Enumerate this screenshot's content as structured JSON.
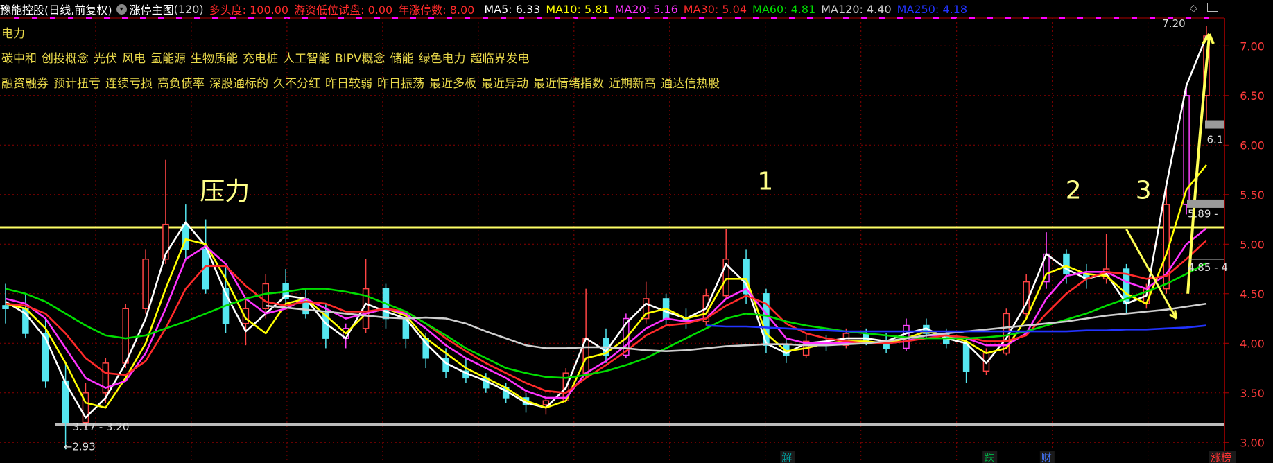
{
  "header": {
    "stock_name": "豫能控股",
    "period": "(日线,前复权)",
    "indicator": "涨停主图",
    "indicator_count": "(120)",
    "metrics": [
      {
        "label": "多头度:",
        "value": "100.00",
        "color": "#ff2a2a"
      },
      {
        "label": "游资低位试盘:",
        "value": "0.00",
        "color": "#ff2a2a"
      },
      {
        "label": "年涨停数:",
        "value": "8.00",
        "color": "#ff2a2a"
      }
    ],
    "ma": [
      {
        "label": "MA5:",
        "value": "6.33",
        "color": "#ffffff"
      },
      {
        "label": "MA10:",
        "value": "5.81",
        "color": "#ffff00"
      },
      {
        "label": "MA20:",
        "value": "5.16",
        "color": "#ff33ff"
      },
      {
        "label": "MA30:",
        "value": "5.04",
        "color": "#ff2a2a"
      },
      {
        "label": "MA60:",
        "value": "4.81",
        "color": "#00dd00"
      },
      {
        "label": "MA120:",
        "value": "4.40",
        "color": "#cfcfcf"
      },
      {
        "label": "MA250:",
        "value": "4.18",
        "color": "#2233ff"
      }
    ]
  },
  "tags": {
    "industry": "电力",
    "concepts": [
      "碳中和",
      "创投概念",
      "光伏",
      "风电",
      "氢能源",
      "生物质能",
      "充电桩",
      "人工智能",
      "BIPV概念",
      "储能",
      "绿色电力",
      "超临界发电"
    ],
    "features": [
      "融资融券",
      "预计扭亏",
      "连续亏损",
      "高负债率",
      "深股通标的",
      "久不分红",
      "昨日较弱",
      "昨日振荡",
      "最近多板",
      "最近异动",
      "最近情绪指数",
      "近期新高",
      "通达信热股"
    ]
  },
  "chart_data": {
    "type": "candlestick",
    "title": "",
    "xlabel": "",
    "ylabel": "",
    "ylim": [
      2.92,
      7.35
    ],
    "y_ticks": [
      "7.00",
      "6.50",
      "6.00",
      "5.50",
      "5.00",
      "4.50",
      "4.00",
      "3.50",
      "3.00"
    ],
    "pressure_line": 5.17,
    "support_line": 3.18,
    "annotations": [
      {
        "text": "压力",
        "x": 0.157,
        "y": 5.45
      },
      {
        "text": "1",
        "x": 0.595,
        "y": 5.55
      },
      {
        "text": "2",
        "x": 0.837,
        "y": 5.46
      },
      {
        "text": "3",
        "x": 0.892,
        "y": 5.46
      }
    ],
    "price_labels": [
      {
        "text": "3.17 - 3.20",
        "x": 0.057,
        "y": 3.12
      },
      {
        "text": "←2.93",
        "x": 0.05,
        "y": 2.92
      },
      {
        "text": "7.20",
        "x": 0.913,
        "y": 7.19
      },
      {
        "text": "5.89 -",
        "x": 0.933,
        "y": 5.27
      },
      {
        "text": "4.85 - 4",
        "x": 0.933,
        "y": 4.73
      },
      {
        "text": "6.1",
        "x": 0.948,
        "y": 6.02
      }
    ],
    "markers": [
      {
        "text": "解",
        "x": 0.614,
        "color": "#00a0a0"
      },
      {
        "text": "跌",
        "x": 0.773,
        "color": "#00aa44"
      },
      {
        "text": "财",
        "x": 0.818,
        "color": "#4477ff"
      },
      {
        "text": "涨榜",
        "x": 0.951,
        "color": "#ff3333"
      }
    ],
    "series": [
      {
        "name": "MA5",
        "color": "#ffffff",
        "values": [
          4.42,
          4.3,
          4.05,
          3.6,
          3.25,
          3.45,
          3.8,
          4.25,
          4.9,
          5.22,
          4.98,
          4.5,
          4.12,
          4.3,
          4.48,
          4.45,
          4.2,
          4.05,
          4.4,
          4.32,
          4.25,
          4.0,
          3.8,
          3.7,
          3.62,
          3.52,
          3.4,
          3.35,
          3.55,
          4.05,
          3.92,
          4.2,
          4.4,
          4.32,
          4.25,
          4.35,
          4.8,
          4.6,
          4.0,
          3.9,
          4.0,
          4.02,
          4.05,
          4.05,
          4.02,
          4.1,
          4.15,
          4.05,
          4.0,
          3.8,
          4.05,
          4.4,
          4.9,
          4.75,
          4.65,
          4.7,
          4.4,
          4.48,
          5.6,
          6.6,
          7.1
        ]
      },
      {
        "name": "MA10",
        "color": "#ffff00",
        "values": [
          4.4,
          4.35,
          4.15,
          3.8,
          3.4,
          3.35,
          3.65,
          4.0,
          4.55,
          5.05,
          5.0,
          4.65,
          4.25,
          4.1,
          4.4,
          4.45,
          4.28,
          4.1,
          4.3,
          4.35,
          4.28,
          4.05,
          3.9,
          3.75,
          3.65,
          3.55,
          3.42,
          3.35,
          3.42,
          3.85,
          3.9,
          4.05,
          4.3,
          4.35,
          4.25,
          4.3,
          4.65,
          4.65,
          4.1,
          3.92,
          3.95,
          4.0,
          4.02,
          4.02,
          4.0,
          4.05,
          4.12,
          4.08,
          4.02,
          3.9,
          3.95,
          4.25,
          4.7,
          4.78,
          4.7,
          4.68,
          4.5,
          4.4,
          4.9,
          5.55,
          5.8
        ]
      },
      {
        "name": "MA20",
        "color": "#ff33ff",
        "values": [
          4.45,
          4.4,
          4.25,
          3.95,
          3.65,
          3.55,
          3.62,
          3.9,
          4.35,
          4.85,
          4.98,
          4.8,
          4.45,
          4.3,
          4.35,
          4.45,
          4.35,
          4.25,
          4.3,
          4.35,
          4.3,
          4.15,
          3.98,
          3.85,
          3.75,
          3.65,
          3.52,
          3.45,
          3.45,
          3.7,
          3.82,
          3.98,
          4.15,
          4.25,
          4.22,
          4.25,
          4.45,
          4.55,
          4.3,
          4.05,
          4.0,
          4.0,
          4.0,
          4.0,
          4.0,
          4.02,
          4.08,
          4.08,
          4.05,
          3.98,
          3.98,
          4.1,
          4.45,
          4.68,
          4.72,
          4.72,
          4.62,
          4.55,
          4.7,
          5.0,
          5.16
        ]
      },
      {
        "name": "MA30",
        "color": "#ff2a2a",
        "values": [
          4.4,
          4.38,
          4.3,
          4.1,
          3.85,
          3.7,
          3.68,
          3.82,
          4.15,
          4.55,
          4.78,
          4.78,
          4.58,
          4.42,
          4.38,
          4.42,
          4.4,
          4.32,
          4.32,
          4.35,
          4.32,
          4.2,
          4.05,
          3.92,
          3.8,
          3.7,
          3.6,
          3.52,
          3.5,
          3.65,
          3.78,
          3.92,
          4.08,
          4.18,
          4.2,
          4.25,
          4.38,
          4.48,
          4.4,
          4.2,
          4.1,
          4.05,
          4.02,
          4.0,
          4.0,
          4.02,
          4.05,
          4.08,
          4.06,
          4.02,
          4.02,
          4.08,
          4.3,
          4.5,
          4.65,
          4.72,
          4.7,
          4.65,
          4.68,
          4.85,
          5.04
        ]
      },
      {
        "name": "MA60",
        "color": "#00dd00",
        "values": [
          4.55,
          4.5,
          4.42,
          4.3,
          4.18,
          4.08,
          4.05,
          4.08,
          4.15,
          4.22,
          4.3,
          4.38,
          4.45,
          4.5,
          4.52,
          4.55,
          4.55,
          4.52,
          4.48,
          4.4,
          4.32,
          4.2,
          4.08,
          3.95,
          3.85,
          3.75,
          3.7,
          3.66,
          3.65,
          3.68,
          3.72,
          3.78,
          3.85,
          3.95,
          4.05,
          4.15,
          4.25,
          4.3,
          4.28,
          4.22,
          4.18,
          4.15,
          4.12,
          4.1,
          4.08,
          4.06,
          4.05,
          4.05,
          4.05,
          4.06,
          4.08,
          4.12,
          4.18,
          4.24,
          4.3,
          4.38,
          4.45,
          4.52,
          4.6,
          4.7,
          4.81
        ]
      },
      {
        "name": "MA120",
        "color": "#cfcfcf",
        "values": [
          null,
          null,
          null,
          null,
          null,
          null,
          null,
          null,
          null,
          null,
          null,
          null,
          null,
          4.38,
          4.36,
          4.34,
          4.32,
          4.3,
          4.28,
          4.26,
          4.25,
          4.26,
          4.25,
          4.2,
          4.12,
          4.05,
          3.98,
          3.95,
          3.95,
          3.96,
          3.96,
          3.95,
          3.93,
          3.92,
          3.93,
          3.95,
          3.97,
          3.98,
          3.99,
          3.99,
          3.98,
          3.98,
          3.99,
          4.0,
          4.02,
          4.05,
          4.08,
          4.1,
          4.12,
          4.14,
          4.16,
          4.18,
          4.2,
          4.22,
          4.25,
          4.28,
          4.3,
          4.32,
          4.34,
          4.37,
          4.4
        ]
      },
      {
        "name": "MA250",
        "color": "#2233ff",
        "values": [
          null,
          null,
          null,
          null,
          null,
          null,
          null,
          null,
          null,
          null,
          null,
          null,
          null,
          null,
          null,
          null,
          null,
          null,
          null,
          null,
          null,
          null,
          null,
          null,
          null,
          null,
          null,
          null,
          null,
          null,
          null,
          null,
          null,
          null,
          null,
          4.18,
          4.17,
          4.17,
          4.16,
          4.15,
          4.14,
          4.13,
          4.12,
          4.12,
          4.12,
          4.12,
          4.12,
          4.12,
          4.12,
          4.12,
          4.12,
          4.12,
          4.12,
          4.12,
          4.13,
          4.13,
          4.14,
          4.14,
          4.15,
          4.16,
          4.18
        ]
      }
    ],
    "candles": [
      {
        "o": 4.38,
        "h": 4.6,
        "l": 4.2,
        "c": 4.35
      },
      {
        "o": 4.35,
        "h": 4.5,
        "l": 4.05,
        "c": 4.1
      },
      {
        "o": 4.1,
        "h": 4.25,
        "l": 3.55,
        "c": 3.62
      },
      {
        "o": 3.62,
        "h": 3.8,
        "l": 2.93,
        "c": 3.2
      },
      {
        "o": 3.2,
        "h": 3.6,
        "l": 3.15,
        "c": 3.5
      },
      {
        "o": 3.5,
        "h": 3.85,
        "l": 3.4,
        "c": 3.8
      },
      {
        "o": 3.8,
        "h": 4.4,
        "l": 3.75,
        "c": 4.35
      },
      {
        "o": 4.35,
        "h": 4.95,
        "l": 4.3,
        "c": 4.85
      },
      {
        "o": 4.85,
        "h": 5.85,
        "l": 4.8,
        "c": 5.2
      },
      {
        "o": 5.2,
        "h": 5.4,
        "l": 4.85,
        "c": 4.95
      },
      {
        "o": 4.95,
        "h": 5.25,
        "l": 4.5,
        "c": 4.55
      },
      {
        "o": 4.55,
        "h": 4.8,
        "l": 4.1,
        "c": 4.2
      },
      {
        "o": 4.2,
        "h": 4.45,
        "l": 3.98,
        "c": 4.35
      },
      {
        "o": 4.35,
        "h": 4.7,
        "l": 4.25,
        "c": 4.6
      },
      {
        "o": 4.6,
        "h": 4.75,
        "l": 4.35,
        "c": 4.45
      },
      {
        "o": 4.45,
        "h": 4.55,
        "l": 4.25,
        "c": 4.3
      },
      {
        "o": 4.3,
        "h": 4.4,
        "l": 3.95,
        "c": 4.05
      },
      {
        "o": 4.05,
        "h": 4.2,
        "l": 3.95,
        "c": 4.15
      },
      {
        "o": 4.15,
        "h": 4.85,
        "l": 4.1,
        "c": 4.55
      },
      {
        "o": 4.55,
        "h": 4.6,
        "l": 4.15,
        "c": 4.25
      },
      {
        "o": 4.25,
        "h": 4.3,
        "l": 3.95,
        "c": 4.05
      },
      {
        "o": 4.05,
        "h": 4.1,
        "l": 3.75,
        "c": 3.85
      },
      {
        "o": 3.85,
        "h": 3.95,
        "l": 3.65,
        "c": 3.72
      },
      {
        "o": 3.72,
        "h": 3.85,
        "l": 3.6,
        "c": 3.65
      },
      {
        "o": 3.65,
        "h": 3.7,
        "l": 3.5,
        "c": 3.55
      },
      {
        "o": 3.55,
        "h": 3.6,
        "l": 3.4,
        "c": 3.45
      },
      {
        "o": 3.45,
        "h": 3.5,
        "l": 3.3,
        "c": 3.38
      },
      {
        "o": 3.38,
        "h": 3.45,
        "l": 3.28,
        "c": 3.42
      },
      {
        "o": 3.42,
        "h": 3.75,
        "l": 3.4,
        "c": 3.7
      },
      {
        "o": 3.7,
        "h": 4.55,
        "l": 3.65,
        "c": 4.05
      },
      {
        "o": 4.05,
        "h": 4.15,
        "l": 3.8,
        "c": 3.88
      },
      {
        "o": 3.88,
        "h": 4.3,
        "l": 3.85,
        "c": 4.25
      },
      {
        "o": 4.25,
        "h": 4.62,
        "l": 4.2,
        "c": 4.45
      },
      {
        "o": 4.45,
        "h": 4.5,
        "l": 4.18,
        "c": 4.25
      },
      {
        "o": 4.25,
        "h": 4.35,
        "l": 4.15,
        "c": 4.22
      },
      {
        "o": 4.22,
        "h": 4.55,
        "l": 4.18,
        "c": 4.48
      },
      {
        "o": 4.48,
        "h": 5.15,
        "l": 4.45,
        "c": 4.85
      },
      {
        "o": 4.85,
        "h": 4.95,
        "l": 4.4,
        "c": 4.5
      },
      {
        "o": 4.5,
        "h": 4.55,
        "l": 3.9,
        "c": 3.98
      },
      {
        "o": 3.98,
        "h": 4.05,
        "l": 3.8,
        "c": 3.88
      },
      {
        "o": 3.88,
        "h": 4.1,
        "l": 3.85,
        "c": 4.02
      },
      {
        "o": 4.02,
        "h": 4.08,
        "l": 3.92,
        "c": 3.98
      },
      {
        "o": 3.98,
        "h": 4.15,
        "l": 3.95,
        "c": 4.1
      },
      {
        "o": 4.1,
        "h": 4.15,
        "l": 3.98,
        "c": 4.02
      },
      {
        "o": 4.02,
        "h": 4.1,
        "l": 3.9,
        "c": 3.95
      },
      {
        "o": 3.95,
        "h": 4.25,
        "l": 3.92,
        "c": 4.18
      },
      {
        "o": 4.18,
        "h": 4.25,
        "l": 4.05,
        "c": 4.1
      },
      {
        "o": 4.1,
        "h": 4.15,
        "l": 3.95,
        "c": 4.0
      },
      {
        "o": 4.0,
        "h": 4.05,
        "l": 3.6,
        "c": 3.72
      },
      {
        "o": 3.72,
        "h": 3.95,
        "l": 3.68,
        "c": 3.9
      },
      {
        "o": 3.9,
        "h": 4.35,
        "l": 3.88,
        "c": 4.3
      },
      {
        "o": 4.3,
        "h": 4.7,
        "l": 4.25,
        "c": 4.62
      },
      {
        "o": 4.62,
        "h": 5.12,
        "l": 4.55,
        "c": 4.9
      },
      {
        "o": 4.9,
        "h": 4.95,
        "l": 4.6,
        "c": 4.7
      },
      {
        "o": 4.7,
        "h": 4.8,
        "l": 4.55,
        "c": 4.65
      },
      {
        "o": 4.65,
        "h": 5.1,
        "l": 4.6,
        "c": 4.75
      },
      {
        "o": 4.75,
        "h": 4.8,
        "l": 4.3,
        "c": 4.4
      },
      {
        "o": 4.4,
        "h": 4.6,
        "l": 4.35,
        "c": 4.55
      },
      {
        "o": 4.55,
        "h": 5.6,
        "l": 4.5,
        "c": 5.4
      },
      {
        "o": 5.4,
        "h": 6.6,
        "l": 5.3,
        "c": 6.5
      },
      {
        "o": 6.5,
        "h": 7.2,
        "l": 6.2,
        "c": 7.1
      }
    ]
  }
}
